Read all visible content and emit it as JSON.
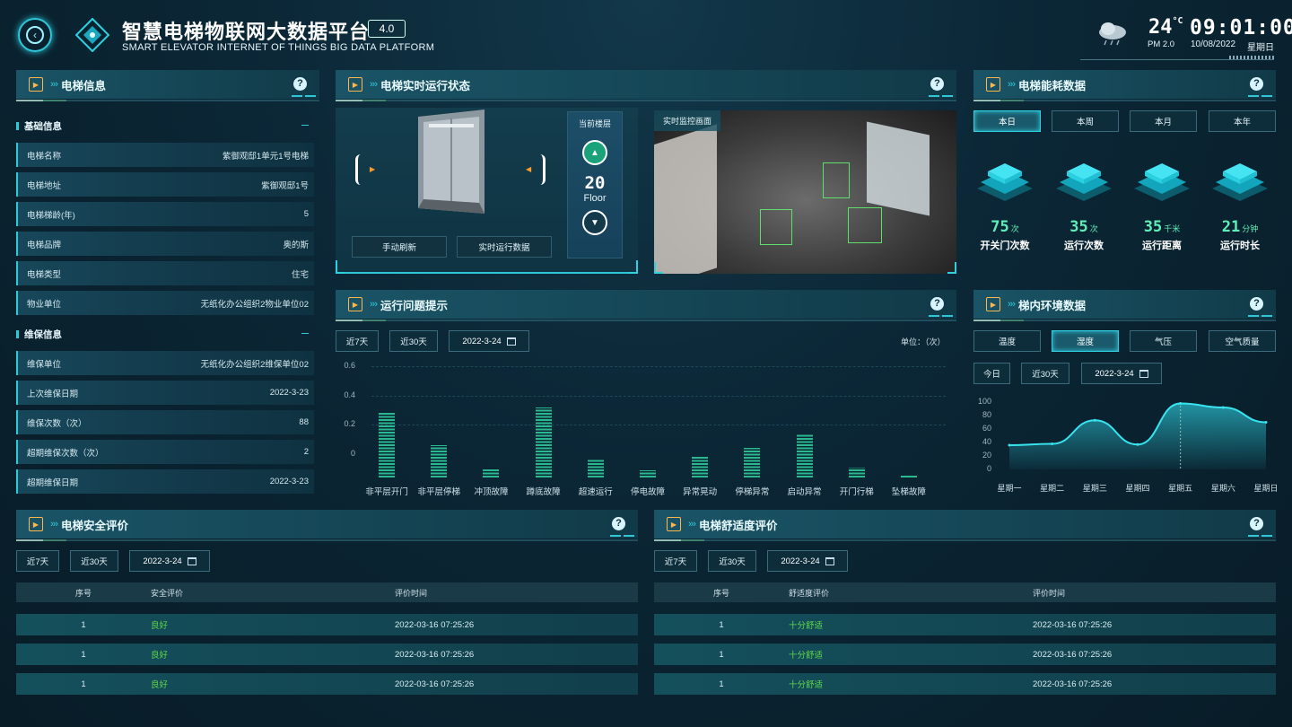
{
  "header": {
    "title": "智慧电梯物联网大数据平台",
    "version": "4.0",
    "subtitle": "SMART ELEVATOR INTERNET OF THINGS BIG DATA PLATFORM",
    "temperature": "24",
    "temp_unit": "°C",
    "pm": "PM 2.0",
    "time": "09:01:00",
    "date": "10/08/2022",
    "weekday": "星期日"
  },
  "info": {
    "title": "电梯信息",
    "basic_title": "基础信息",
    "basic": [
      {
        "k": "电梯名称",
        "v": "紫御观邸1单元1号电梯"
      },
      {
        "k": "电梯地址",
        "v": "紫御观邸1号"
      },
      {
        "k": "电梯梯龄(年)",
        "v": "5"
      },
      {
        "k": "电梯品牌",
        "v": "奥的斯"
      },
      {
        "k": "电梯类型",
        "v": "住宅"
      },
      {
        "k": "物业单位",
        "v": "无纸化办公组织2物业单位02"
      }
    ],
    "maint_title": "维保信息",
    "maint": [
      {
        "k": "维保单位",
        "v": "无纸化办公组织2维保单位02"
      },
      {
        "k": "上次维保日期",
        "v": "2022-3-23"
      },
      {
        "k": "维保次数（次）",
        "v": "88"
      },
      {
        "k": "超期维保次数（次）",
        "v": "2"
      },
      {
        "k": "超期维保日期",
        "v": "2022-3-23"
      }
    ]
  },
  "status": {
    "title": "电梯实时运行状态",
    "floor_label": "当前楼层",
    "floor": "20",
    "floor_en": "Floor",
    "btn_refresh": "手动刷新",
    "btn_realtime": "实时运行数据",
    "monitor_label": "实时监控画面"
  },
  "energy": {
    "title": "电梯能耗数据",
    "tabs": [
      "本日",
      "本周",
      "本月",
      "本年"
    ],
    "stats": [
      {
        "num": "75",
        "unit": "次",
        "label": "开关门次数"
      },
      {
        "num": "35",
        "unit": "次",
        "label": "运行次数"
      },
      {
        "num": "35",
        "unit": "千米",
        "label": "运行距离"
      },
      {
        "num": "21",
        "unit": "分钟",
        "label": "运行时长"
      }
    ]
  },
  "issues": {
    "title": "运行问题提示",
    "btn7": "近7天",
    "btn30": "近30天",
    "date": "2022-3-24",
    "unit": "单位：（次）"
  },
  "chart_data": [
    {
      "type": "bar",
      "title": "运行问题提示",
      "categories": [
        "非平层开门",
        "非平层停梯",
        "冲顶故障",
        "蹲底故障",
        "超速运行",
        "停电故障",
        "异常晃动",
        "停梯异常",
        "启动异常",
        "开门行梯",
        "坠梯故障"
      ],
      "values": [
        0.44,
        0.22,
        0.06,
        0.48,
        0.12,
        0.05,
        0.14,
        0.2,
        0.3,
        0.07,
        0.01
      ],
      "yticks": [
        "0.6",
        "0.4",
        "0.2",
        "0"
      ]
    },
    {
      "type": "area",
      "title": "梯内环境数据",
      "categories": [
        "星期一",
        "星期二",
        "星期三",
        "星期四",
        "星期五",
        "星期六",
        "星期日"
      ],
      "values": [
        36,
        38,
        73,
        37,
        98,
        92,
        70
      ],
      "ylim": [
        0,
        100
      ],
      "yticks": [
        "100",
        "80",
        "60",
        "40",
        "20",
        "0"
      ]
    }
  ],
  "env": {
    "title": "梯内环境数据",
    "tabs": [
      "温度",
      "湿度",
      "气压",
      "空气质量"
    ],
    "btn_today": "今日",
    "btn30": "近30天",
    "date": "2022-3-24"
  },
  "safety": {
    "title": "电梯安全评价",
    "btn7": "近7天",
    "btn30": "近30天",
    "date": "2022-3-24",
    "cols": [
      "序号",
      "安全评价",
      "评价时间"
    ],
    "rows": [
      [
        "1",
        "良好",
        "2022-03-16 07:25:26"
      ],
      [
        "1",
        "良好",
        "2022-03-16 07:25:26"
      ],
      [
        "1",
        "良好",
        "2022-03-16 07:25:26"
      ]
    ]
  },
  "comfort": {
    "title": "电梯舒适度评价",
    "btn7": "近7天",
    "btn30": "近30天",
    "date": "2022-3-24",
    "cols": [
      "序号",
      "舒适度评价",
      "评价时间"
    ],
    "rows": [
      [
        "1",
        "十分舒适",
        "2022-03-16 07:25:26"
      ],
      [
        "1",
        "十分舒适",
        "2022-03-16 07:25:26"
      ],
      [
        "1",
        "十分舒适",
        "2022-03-16 07:25:26"
      ]
    ]
  }
}
